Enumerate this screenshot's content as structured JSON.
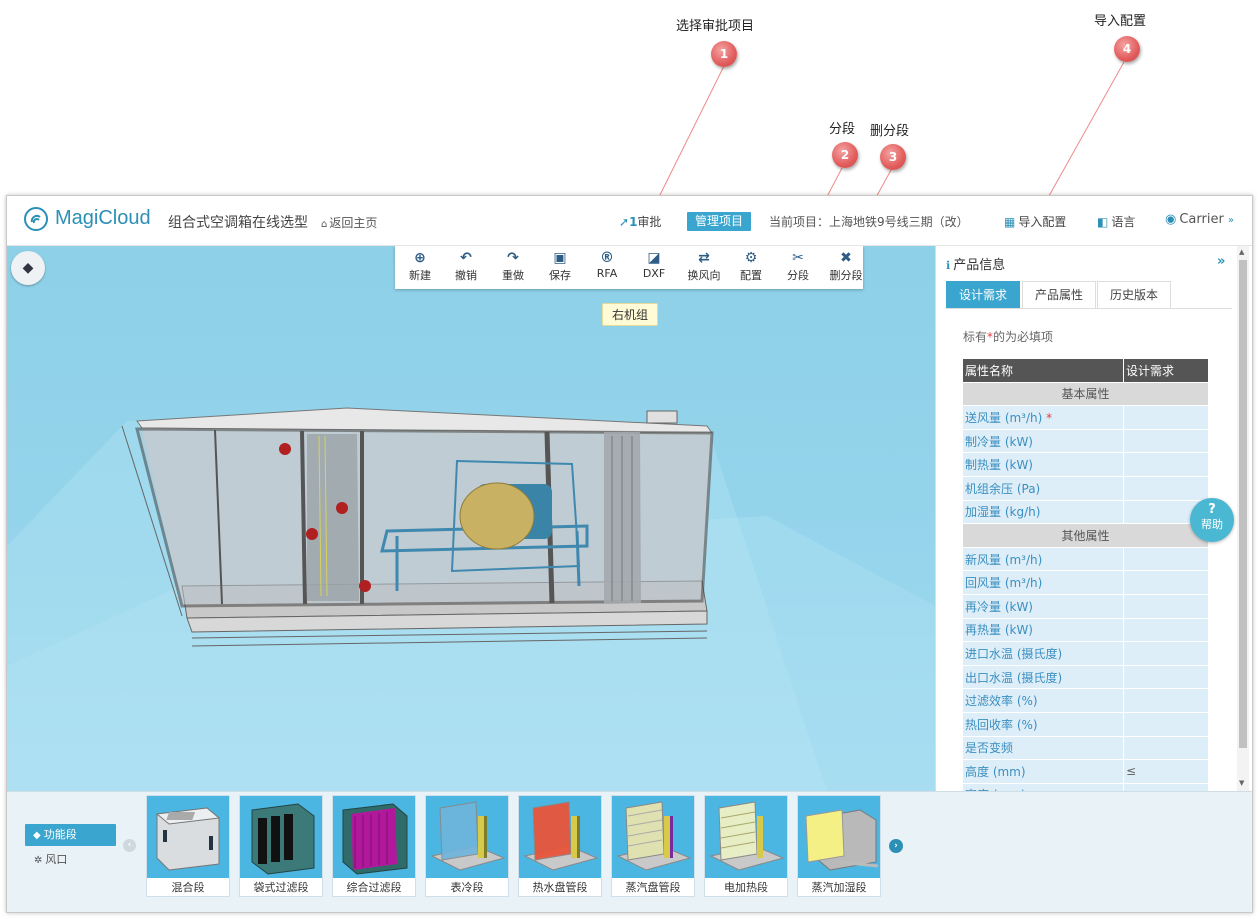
{
  "annotations": [
    {
      "num": "1",
      "label": "选择审批项目"
    },
    {
      "num": "2",
      "label": "分段"
    },
    {
      "num": "3",
      "label": "删分段"
    },
    {
      "num": "4",
      "label": "导入配置"
    }
  ],
  "header": {
    "logo": "MagiCloud",
    "title": "组合式空调箱在线选型",
    "home_link": "返回主页",
    "approve_count": "1",
    "approve_label": "审批",
    "manage_button": "管理项目",
    "current_project": "当前项目：上海地铁9号线三期（改）",
    "import_config": "导入配置",
    "language": "语言",
    "user": "Carrier"
  },
  "toolbar": [
    {
      "icon": "plus-circle-icon",
      "glyph": "⊕",
      "label": "新建"
    },
    {
      "icon": "undo-icon",
      "glyph": "↶",
      "label": "撤销"
    },
    {
      "icon": "redo-icon",
      "glyph": "↷",
      "label": "重做"
    },
    {
      "icon": "save-icon",
      "glyph": "▣",
      "label": "保存"
    },
    {
      "icon": "rfa-icon",
      "glyph": "®",
      "label": "RFA"
    },
    {
      "icon": "dxf-icon",
      "glyph": "◪",
      "label": "DXF"
    },
    {
      "icon": "swap-direction-icon",
      "glyph": "⇄",
      "label": "换风向"
    },
    {
      "icon": "gear-icon",
      "glyph": "⚙",
      "label": "配置"
    },
    {
      "icon": "scissors-icon",
      "glyph": "✂",
      "label": "分段"
    },
    {
      "icon": "close-icon",
      "glyph": "✖",
      "label": "删分段"
    }
  ],
  "viewport": {
    "unit_tag": "右机组",
    "help_symbol": "?",
    "help_label": "帮助"
  },
  "panel": {
    "title": "产品信息",
    "collapse": "»",
    "tabs": [
      "设计需求",
      "产品属性",
      "历史版本"
    ],
    "active_tab": 0,
    "note_prefix": "标有",
    "note_star": "*",
    "note_suffix": "的为必填项",
    "col_name": "属性名称",
    "col_value": "设计需求",
    "basic_group": "基本属性",
    "basic_rows": [
      {
        "name": "送风量 (m³/h)",
        "required": true,
        "value": ""
      },
      {
        "name": "制冷量 (kW)",
        "required": false,
        "value": ""
      },
      {
        "name": "制热量 (kW)",
        "required": false,
        "value": ""
      },
      {
        "name": "机组余压 (Pa)",
        "required": false,
        "value": ""
      },
      {
        "name": "加湿量 (kg/h)",
        "required": false,
        "value": ""
      }
    ],
    "other_group": "其他属性",
    "other_rows": [
      {
        "name": "新风量 (m³/h)",
        "value": ""
      },
      {
        "name": "回风量 (m³/h)",
        "value": ""
      },
      {
        "name": "再冷量 (kW)",
        "value": ""
      },
      {
        "name": "再热量 (kW)",
        "value": ""
      },
      {
        "name": "进口水温 (摄氏度)",
        "value": ""
      },
      {
        "name": "出口水温 (摄氏度)",
        "value": ""
      },
      {
        "name": "过滤效率 (%)",
        "value": ""
      },
      {
        "name": "热回收率 (%)",
        "value": ""
      },
      {
        "name": "是否变频",
        "value": ""
      },
      {
        "name": "高度 (mm)",
        "value": "≤"
      },
      {
        "name": "宽度 (mm)",
        "value": "≤"
      }
    ]
  },
  "palette": {
    "categories": [
      "功能段",
      "风口"
    ],
    "sections": [
      {
        "label": "混合段",
        "kind": "mix"
      },
      {
        "label": "袋式过滤段",
        "kind": "bag"
      },
      {
        "label": "综合过滤段",
        "kind": "combo"
      },
      {
        "label": "表冷段",
        "kind": "cool"
      },
      {
        "label": "热水盘管段",
        "kind": "hot"
      },
      {
        "label": "蒸汽盘管段",
        "kind": "steam"
      },
      {
        "label": "电加热段",
        "kind": "elec"
      },
      {
        "label": "蒸汽加湿段",
        "kind": "humid"
      }
    ]
  },
  "colors": {
    "accent": "#3aa6cf",
    "brand": "#2c8fb5",
    "annotation": "#e25c5c",
    "viewport_bg": "#96d5ec"
  }
}
